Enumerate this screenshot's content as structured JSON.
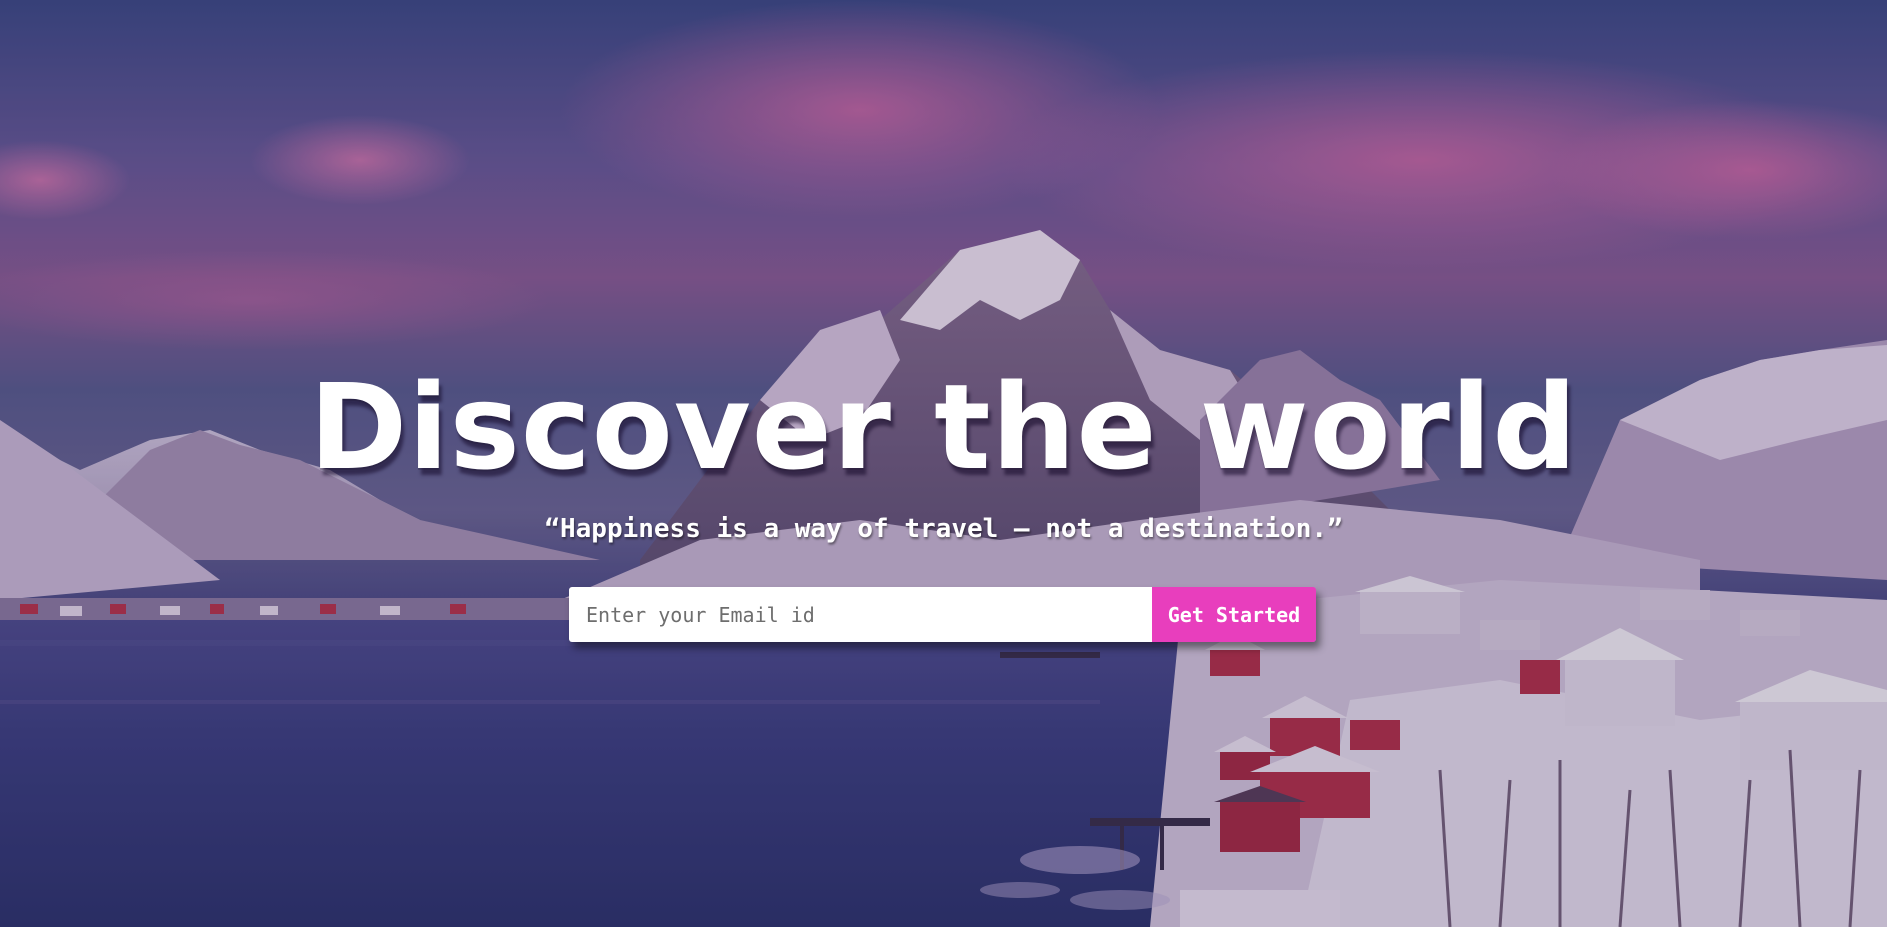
{
  "hero": {
    "headline": "Discover the world",
    "quote": "“Happiness is a way of travel – not a destination.”"
  },
  "signup": {
    "email_placeholder": "Enter your Email id",
    "button_label": "Get Started"
  },
  "colors": {
    "accent": "#e83ebd",
    "text": "#ffffff"
  }
}
